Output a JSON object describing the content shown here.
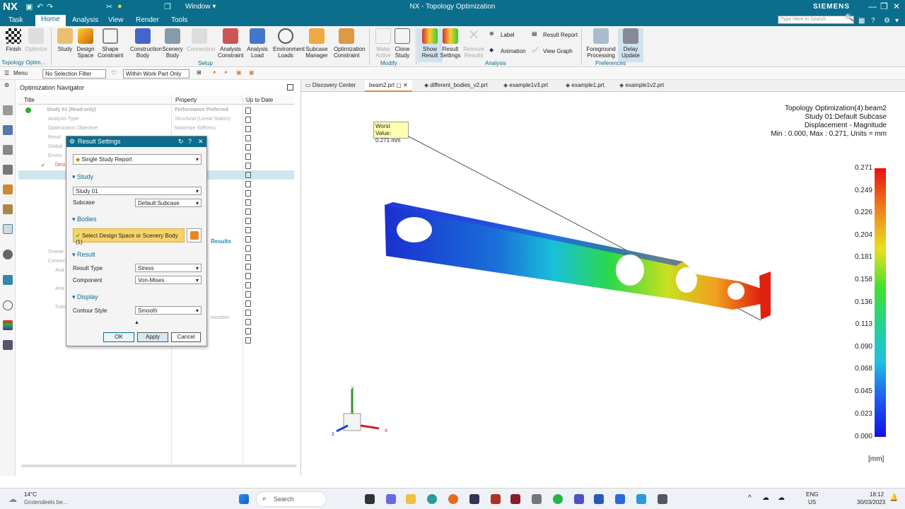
{
  "titlebar": {
    "logo": "NX",
    "window_menu": "Window ▾",
    "title": "NX - Topology Optimization",
    "brand": "SIEMENS"
  },
  "tabs": [
    "Task",
    "Home",
    "Analysis",
    "View",
    "Render",
    "Tools"
  ],
  "search_placeholder": "Type Here to Search",
  "ribbon": {
    "finish": "Finish",
    "optimize": "Optimize",
    "topology_optim": "Topology Optim...",
    "setup": [
      "Study",
      "Design Space",
      "Shape Constraint",
      "Construction Body",
      "Scenery Body",
      "Connection",
      "Analysis Constraint",
      "Analysis Load",
      "Environment Loads",
      "Subcase Manager",
      "Optimization Constraint"
    ],
    "setup_group": "Setup",
    "modify": [
      "Make Active",
      "Clone Study"
    ],
    "modify_group": "Modify",
    "analysis": [
      "Show Result",
      "Result Settings",
      "Remove Results"
    ],
    "analysis_small": [
      "Label",
      "Animation",
      "Result Report",
      "View Graph"
    ],
    "analysis_group": "Analysis",
    "prefs": [
      "Foreground Processing",
      "Delay Update"
    ],
    "prefs_group": "Preferences"
  },
  "selbar": {
    "menu": "Menu",
    "filter": "No Selection Filter",
    "scope": "Within Work Part Only"
  },
  "navigator": {
    "title": "Optimization Navigator",
    "cols": [
      "Title",
      "Property",
      "Up to Date"
    ],
    "study": "Study 01 (Read-only)",
    "study_prop": "Performance Preferred",
    "rows": [
      {
        "t": "Analysis Type",
        "p": "Structural (Linear Statics)"
      },
      {
        "t": "Optimization Objective",
        "p": "Maximize Stiffness"
      },
      {
        "t": "Resol",
        "p": ""
      },
      {
        "t": "Global",
        "p": ""
      },
      {
        "t": "Enviro",
        "p": ""
      },
      {
        "t": "Desi",
        "p": ""
      }
    ],
    "more_rows": [
      "Scener",
      "Connec",
      "Ana",
      "Ana",
      "Subc"
    ],
    "results_link": "Results",
    "opt_text": "mization"
  },
  "dialog": {
    "title": "Result Settings",
    "report": "Single Study Report",
    "study_section": "Study",
    "study_value": "Study 01",
    "subcase_label": "Subcase",
    "subcase_value": "Default Subcase",
    "bodies_section": "Bodies",
    "bodies_select": "Select Design Space or Scenery Body (1)",
    "result_section": "Result",
    "result_type_label": "Result Type",
    "result_type": "Stress",
    "component_label": "Component",
    "component": "Von-Mises",
    "display_section": "Display",
    "contour_label": "Contour Style",
    "contour": "Smooth",
    "ok": "OK",
    "apply": "Apply",
    "cancel": "Cancel"
  },
  "viewtabs": [
    "Discovery Center",
    "beam2.prt",
    "different_bodies_v2.prt",
    "example1v3.prt",
    "example1.prt",
    "example1v2.prt"
  ],
  "viewport": {
    "info": [
      "Topology Optimization(4):beam2",
      "Study 01:Default Subcase",
      "Displacement - Magnitude",
      "Min : 0.000, Max : 0.271, Units = mm"
    ],
    "worst_label": "Worst Value:",
    "worst_value": "0.271 mm",
    "legend": [
      "0.271",
      "0.249",
      "0.226",
      "0.204",
      "0.181",
      "0.158",
      "0.136",
      "0.113",
      "0.090",
      "0.068",
      "0.045",
      "0.023",
      "0.000"
    ],
    "units": "[mm]",
    "axis_x": "x",
    "axis_y": "y",
    "axis_z": "z"
  },
  "taskbar": {
    "temp": "14°C",
    "weather": "Grotendeels be...",
    "search": "Search",
    "lang": "ENG",
    "region": "US",
    "time": "18:12",
    "date": "30/03/2023"
  }
}
